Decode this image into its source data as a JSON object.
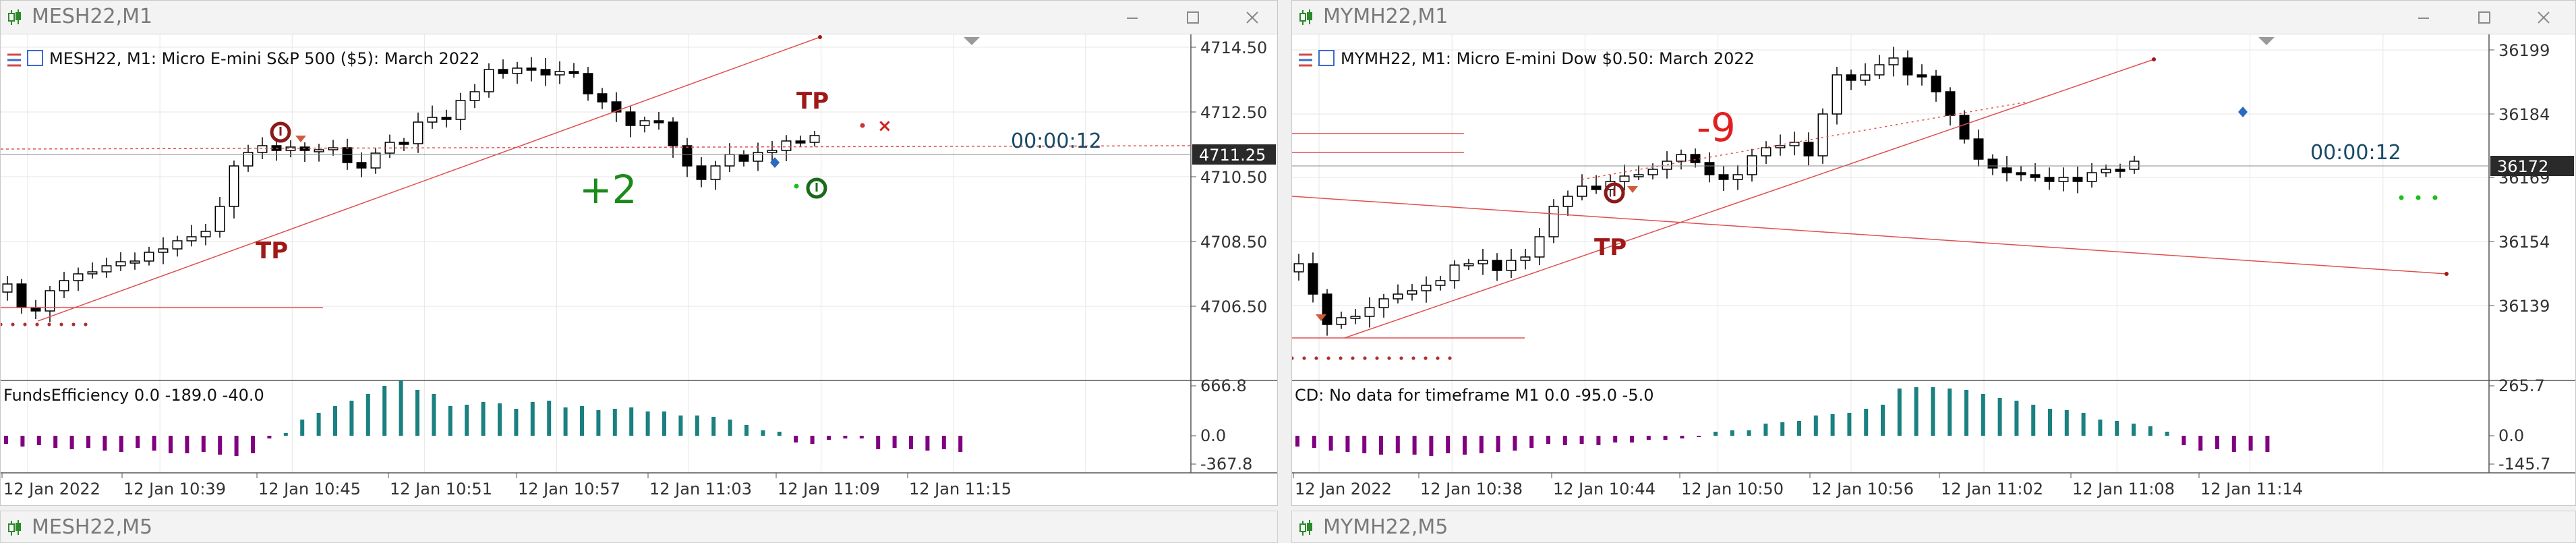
{
  "windows": [
    {
      "id": "mes",
      "title": "MESH22,M1",
      "header": "MESH22, M1:  Micro E-mini S&P 500 ($5): March 2022",
      "price_labels": [
        "4714.50",
        "4712.50",
        "4710.50",
        "4708.50",
        "4706.50"
      ],
      "current_price": "4711.25",
      "countdown": "00:00:12",
      "pnl": "+2",
      "tp_labels": [
        "TP",
        "TP"
      ],
      "indicator_label": "FundsEfficiency 0.0 -189.0 -40.0",
      "indicator_scale": [
        "666.8",
        "0.0",
        "-367.8"
      ],
      "time_labels": [
        "12 Jan 2022",
        "12 Jan 10:39",
        "12 Jan 10:45",
        "12 Jan 10:51",
        "12 Jan 10:57",
        "12 Jan 11:03",
        "12 Jan 11:09",
        "12 Jan 11:15"
      ]
    },
    {
      "id": "mym",
      "title": "MYMH22,M1",
      "header": "MYMH22, M1:  Micro E-mini Dow $0.50: March 2022",
      "price_labels": [
        "36199",
        "36184",
        "36169",
        "36154",
        "36139"
      ],
      "current_price": "36172",
      "countdown": "00:00:12",
      "pnl": "-9",
      "tp_labels": [
        "TP"
      ],
      "indicator_label": "CD: No data for timeframe M1 0.0 -95.0 -5.0",
      "indicator_scale": [
        "265.7",
        "0.0",
        "-145.7"
      ],
      "time_labels": [
        "12 Jan 2022",
        "12 Jan 10:38",
        "12 Jan 10:44",
        "12 Jan 10:50",
        "12 Jan 10:56",
        "12 Jan 11:02",
        "12 Jan 11:08",
        "12 Jan 11:14"
      ]
    }
  ],
  "minimized": [
    "MESH22,M5",
    "MYMH22,M5"
  ],
  "colors": {
    "bull_fill": "#ffffff",
    "bear_fill": "#000000",
    "candle_stroke": "#000000",
    "trend_line": "#e05050",
    "dotted_level": "#b03030",
    "tp_text": "#a01818",
    "pnl_positive": "#1a8a1a",
    "pnl_negative": "#e02020",
    "hist_positive": "#1a8080",
    "hist_negative": "#800080",
    "countdown_text": "#1a4a66",
    "price_box": "#2a2a2a"
  },
  "icons": {
    "candlestick_icon": "candlestick-icon",
    "minimize": "minimize-icon",
    "maximize": "maximize-icon",
    "close": "close-icon",
    "header_menu": "chart-menu-icon",
    "trade_open_bull": "buy-arrow-icon",
    "trade_open_bear": "sell-arrow-icon",
    "trade_marker_circle": "trade-circle-icon",
    "trade_close_x": "close-x-icon"
  }
}
